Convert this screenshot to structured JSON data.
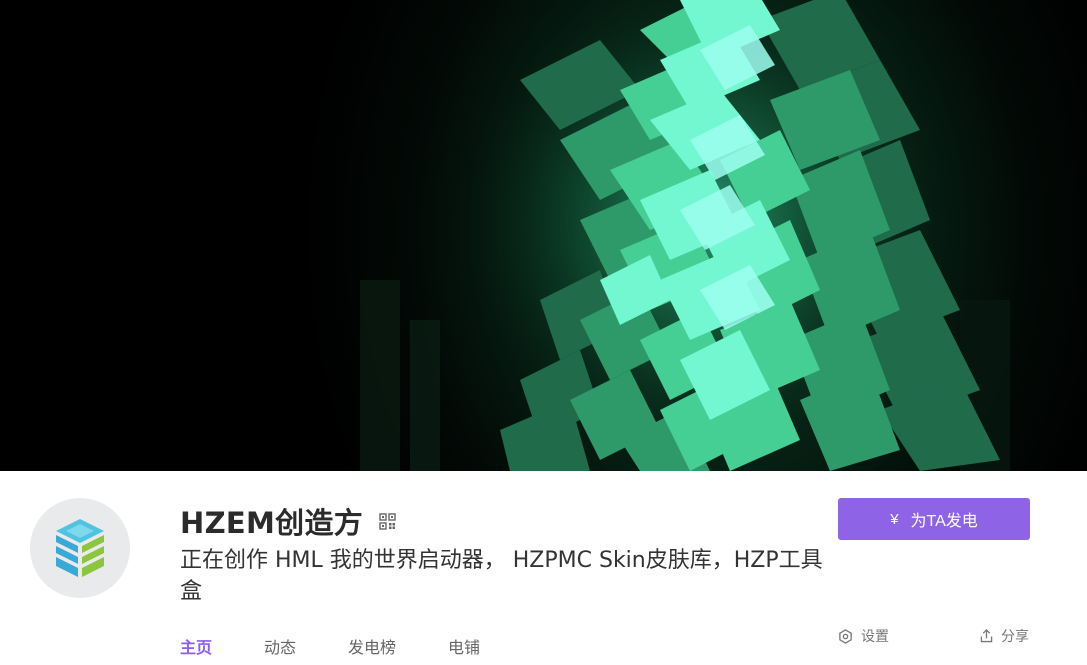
{
  "profile": {
    "name": "HZEM创造方",
    "description": "正在创作 HML 我的世界启动器， HZPMC Skin皮肤库，HZP工具盒",
    "charge_button": {
      "icon_symbol": "¥",
      "label": "为TA发电"
    },
    "tabs": [
      {
        "label": "主页",
        "active": true
      },
      {
        "label": "动态",
        "active": false
      },
      {
        "label": "发电榜",
        "active": false
      },
      {
        "label": "电铺",
        "active": false
      }
    ],
    "actions": {
      "settings_label": "设置",
      "share_label": "分享"
    }
  },
  "icons": {
    "qr": "qr-code-icon",
    "settings": "settings-hexagon-icon",
    "share": "share-upload-icon"
  },
  "colors": {
    "accent": "#8f63e6",
    "active_tab": "#8b5cf6",
    "banner_glow": "#4dfcd8"
  }
}
